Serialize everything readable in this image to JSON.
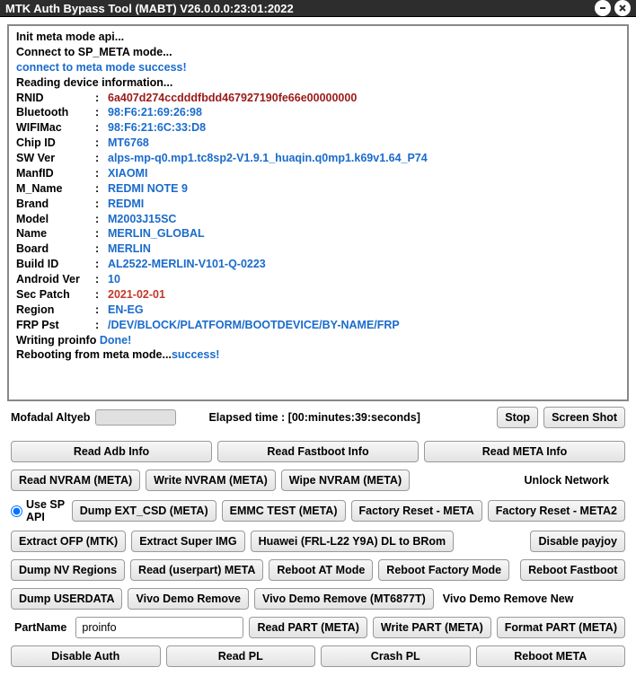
{
  "title": "MTK Auth Bypass Tool (MABT) V26.0.0.0:23:01:2022",
  "log": {
    "line0": "Init meta mode api...",
    "line1": "Connect to SP_META mode...",
    "line2": "connect to meta mode success!",
    "line3": "Reading device information...",
    "kv": [
      {
        "label": "RNID",
        "value": "6a407d274ccdddfbdd467927190fe66e00000000",
        "cls": "log-darkred"
      },
      {
        "label": "Bluetooth",
        "value": "98:F6:21:69:26:98",
        "cls": "log-blue"
      },
      {
        "label": "WIFIMac",
        "value": "98:F6:21:6C:33:D8",
        "cls": "log-blue"
      },
      {
        "label": "Chip ID",
        "value": "MT6768",
        "cls": "log-blue"
      },
      {
        "label": "SW Ver",
        "value": "alps-mp-q0.mp1.tc8sp2-V1.9.1_huaqin.q0mp1.k69v1.64_P74",
        "cls": "log-blue"
      },
      {
        "label": "ManfID",
        "value": "XIAOMI",
        "cls": "log-blue"
      },
      {
        "label": "M_Name",
        "value": "REDMI NOTE 9",
        "cls": "log-blue"
      },
      {
        "label": "Brand",
        "value": "REDMI",
        "cls": "log-blue"
      },
      {
        "label": "Model",
        "value": "M2003J15SC",
        "cls": "log-blue"
      },
      {
        "label": "Name",
        "value": "MERLIN_GLOBAL",
        "cls": "log-blue"
      },
      {
        "label": "Board",
        "value": "MERLIN",
        "cls": "log-blue"
      },
      {
        "label": "Build ID",
        "value": "AL2522-MERLIN-V101-Q-0223",
        "cls": "log-blue"
      },
      {
        "label": "Android Ver",
        "value": "10",
        "cls": "log-blue"
      },
      {
        "label": "Sec Patch",
        "value": "2021-02-01",
        "cls": "log-crimson"
      },
      {
        "label": "Region",
        "value": "EN-EG",
        "cls": "log-blue"
      },
      {
        "label": "FRP Pst",
        "value": "/DEV/BLOCK/PLATFORM/BOOTDEVICE/BY-NAME/FRP",
        "cls": "log-blue"
      }
    ],
    "writing_a": "Writing proinfo ",
    "writing_b": "Done!",
    "reboot_a": "Rebooting from meta mode...",
    "reboot_b": "success!"
  },
  "status": {
    "author": "Mofadal Altyeb",
    "elapsed": "Elapsed time : [00:minutes:39:seconds]",
    "stop": "Stop",
    "screenshot": "Screen Shot"
  },
  "row1": {
    "a": "Read Adb Info",
    "b": "Read Fastboot Info",
    "c": "Read META Info"
  },
  "row2": {
    "a": "Read NVRAM (META)",
    "b": "Write NVRAM (META)",
    "c": "Wipe NVRAM (META)",
    "d": "Unlock Network"
  },
  "row3": {
    "radio": "Use SP API",
    "a": "Dump  EXT_CSD (META)",
    "b": "EMMC TEST (META)",
    "c": "Factory Reset - META",
    "d": "Factory Reset - META2"
  },
  "row4": {
    "a": "Extract OFP (MTK)",
    "b": "Extract Super IMG",
    "c": "Huawei (FRL-L22 Y9A) DL to BRom",
    "d": "Disable payjoy"
  },
  "row5": {
    "a": "Dump NV Regions",
    "b": "Read (userpart) META",
    "c": "Reboot AT Mode",
    "d": "Reboot Factory Mode",
    "e": "Reboot Fastboot"
  },
  "row6": {
    "a": "Dump USERDATA",
    "b": "Vivo Demo Remove",
    "c": "Vivo Demo Remove (MT6877T)",
    "d": "Vivo Demo Remove New"
  },
  "partname": {
    "label": "PartName",
    "value": "proinfo",
    "read": "Read PART (META)",
    "write": "Write PART (META)",
    "format": "Format PART (META)"
  },
  "row8": {
    "a": "Disable Auth",
    "b": "Read PL",
    "c": "Crash PL",
    "d": "Reboot META"
  }
}
